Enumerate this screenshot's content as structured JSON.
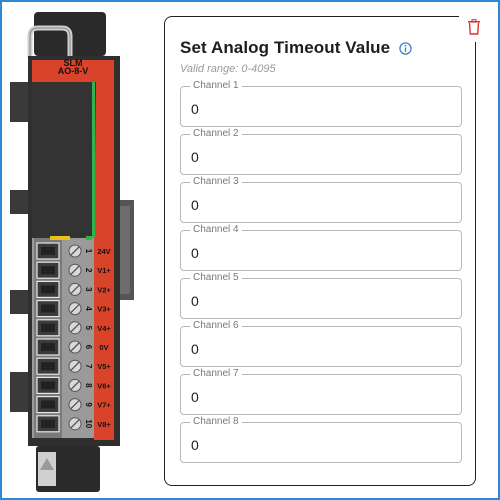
{
  "device": {
    "brand": "SLM",
    "model": "AO-8-V",
    "terminals": [
      {
        "number": "1",
        "label": "24V"
      },
      {
        "number": "2",
        "label": "V1+"
      },
      {
        "number": "3",
        "label": "V2+"
      },
      {
        "number": "4",
        "label": "V3+"
      },
      {
        "number": "5",
        "label": "V4+"
      },
      {
        "number": "6",
        "label": "0V"
      },
      {
        "number": "7",
        "label": "V5+"
      },
      {
        "number": "8",
        "label": "V6+"
      },
      {
        "number": "9",
        "label": "V7+"
      },
      {
        "number": "10",
        "label": "V8+"
      }
    ]
  },
  "dialog": {
    "title": "Set Analog Timeout Value",
    "subtitle": "Valid range: 0-4095",
    "info_icon": "info-circle-icon",
    "delete_icon": "trash-icon",
    "channels": [
      {
        "label": "Channel 1",
        "value": "0"
      },
      {
        "label": "Channel 2",
        "value": "0"
      },
      {
        "label": "Channel 3",
        "value": "0"
      },
      {
        "label": "Channel 4",
        "value": "0"
      },
      {
        "label": "Channel 5",
        "value": "0"
      },
      {
        "label": "Channel 6",
        "value": "0"
      },
      {
        "label": "Channel 7",
        "value": "0"
      },
      {
        "label": "Channel 8",
        "value": "0"
      }
    ]
  },
  "colors": {
    "accent": "#2f87cf",
    "device_red": "#d9432a",
    "delete_red": "#e0312e",
    "info_blue": "#2b7bd0"
  }
}
